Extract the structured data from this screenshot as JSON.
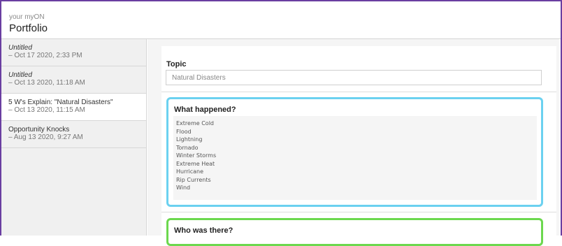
{
  "header": {
    "subtitle": "your myON",
    "title": "Portfolio"
  },
  "sidebar": {
    "items": [
      {
        "name": "Untitled",
        "date": "– Oct 17 2020, 2:33 PM",
        "italic": true,
        "active": false
      },
      {
        "name": "Untitled",
        "date": "– Oct 13 2020, 11:18 AM",
        "italic": true,
        "active": false
      },
      {
        "name": "5 W's Explain: \"Natural Disasters\"",
        "date": "– Oct 13 2020, 11:15 AM",
        "italic": false,
        "active": true
      },
      {
        "name": "Opportunity Knocks",
        "date": "– Aug 13 2020, 9:27 AM",
        "italic": false,
        "active": false
      }
    ]
  },
  "main": {
    "topic_label": "Topic",
    "topic_value": "Natural Disasters",
    "sections": [
      {
        "title": "What happened?",
        "border_color": "#6bd1f0",
        "lines": [
          "Extreme Cold",
          "Flood",
          "Lightning",
          "Tornado",
          "Winter Storms",
          "Extreme Heat",
          "Hurricane",
          "Rip Currents",
          "Wind"
        ]
      },
      {
        "title": "Who was there?",
        "border_color": "#6cd84e",
        "lines": []
      }
    ]
  },
  "colors": {
    "frame_accent": "#6a3ea1",
    "sidebar_bg": "#f0f0f0"
  }
}
